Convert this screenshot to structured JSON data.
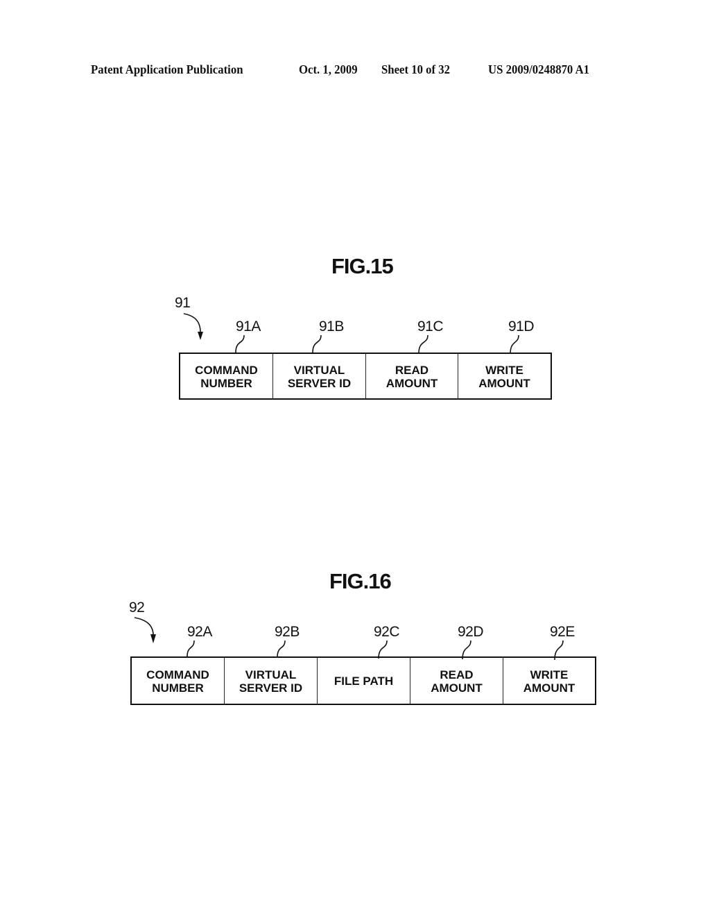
{
  "header": {
    "publication": "Patent Application Publication",
    "date": "Oct. 1, 2009",
    "sheet": "Sheet 10 of 32",
    "number": "US 2009/0248870 A1"
  },
  "figures": [
    {
      "title": "FIG.15",
      "ref": "91",
      "fields": [
        {
          "ref": "91A",
          "label": "COMMAND\nNUMBER"
        },
        {
          "ref": "91B",
          "label": "VIRTUAL\nSERVER ID"
        },
        {
          "ref": "91C",
          "label": "READ\nAMOUNT"
        },
        {
          "ref": "91D",
          "label": "WRITE\nAMOUNT"
        }
      ]
    },
    {
      "title": "FIG.16",
      "ref": "92",
      "fields": [
        {
          "ref": "92A",
          "label": "COMMAND\nNUMBER"
        },
        {
          "ref": "92B",
          "label": "VIRTUAL\nSERVER ID"
        },
        {
          "ref": "92C",
          "label": "FILE PATH"
        },
        {
          "ref": "92D",
          "label": "READ\nAMOUNT"
        },
        {
          "ref": "92E",
          "label": "WRITE\nAMOUNT"
        }
      ]
    }
  ]
}
